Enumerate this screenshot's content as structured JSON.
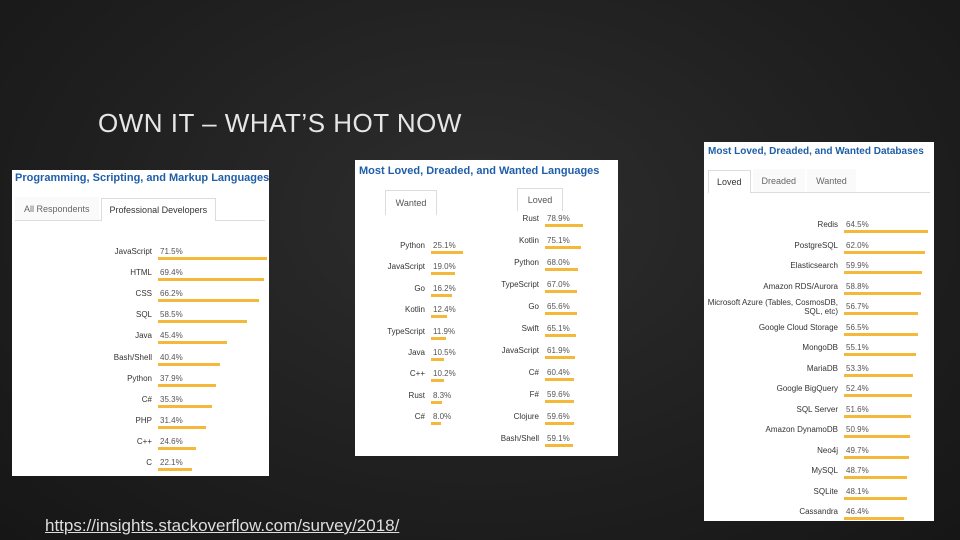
{
  "slide": {
    "title": "OWN IT – WHAT’S HOT NOW",
    "source_url": "https://insights.stackoverflow.com/survey/2018/"
  },
  "colors": {
    "bar": "#f4b93b",
    "title_blue": "#1f5ea8",
    "background": "#232323"
  },
  "panel_languages": {
    "title": "Programming, Scripting, and Markup Languages",
    "tabs": [
      "All Respondents",
      "Professional Developers"
    ],
    "active_tab": 1,
    "rows": [
      {
        "label": "JavaScript",
        "value": "71.5%",
        "pct": 71.5
      },
      {
        "label": "HTML",
        "value": "69.4%",
        "pct": 69.4
      },
      {
        "label": "CSS",
        "value": "66.2%",
        "pct": 66.2
      },
      {
        "label": "SQL",
        "value": "58.5%",
        "pct": 58.5
      },
      {
        "label": "Java",
        "value": "45.4%",
        "pct": 45.4
      },
      {
        "label": "Bash/Shell",
        "value": "40.4%",
        "pct": 40.4
      },
      {
        "label": "Python",
        "value": "37.9%",
        "pct": 37.9
      },
      {
        "label": "C#",
        "value": "35.3%",
        "pct": 35.3
      },
      {
        "label": "PHP",
        "value": "31.4%",
        "pct": 31.4
      },
      {
        "label": "C++",
        "value": "24.6%",
        "pct": 24.6
      },
      {
        "label": "C",
        "value": "22.1%",
        "pct": 22.1
      }
    ]
  },
  "panel_loved": {
    "title": "Most Loved, Dreaded, and Wanted Languages",
    "wanted_tab": "Wanted",
    "loved_tab": "Loved",
    "wanted_rows": [
      {
        "label": "Python",
        "value": "25.1%",
        "pct": 25.1
      },
      {
        "label": "JavaScript",
        "value": "19.0%",
        "pct": 19.0
      },
      {
        "label": "Go",
        "value": "16.2%",
        "pct": 16.2
      },
      {
        "label": "Kotlin",
        "value": "12.4%",
        "pct": 12.4
      },
      {
        "label": "TypeScript",
        "value": "11.9%",
        "pct": 11.9
      },
      {
        "label": "Java",
        "value": "10.5%",
        "pct": 10.5
      },
      {
        "label": "C++",
        "value": "10.2%",
        "pct": 10.2
      },
      {
        "label": "Rust",
        "value": "8.3%",
        "pct": 8.3
      },
      {
        "label": "C#",
        "value": "8.0%",
        "pct": 8.0
      }
    ],
    "loved_rows": [
      {
        "label": "Rust",
        "value": "78.9%",
        "pct": 78.9
      },
      {
        "label": "Kotlin",
        "value": "75.1%",
        "pct": 75.1
      },
      {
        "label": "Python",
        "value": "68.0%",
        "pct": 68.0
      },
      {
        "label": "TypeScript",
        "value": "67.0%",
        "pct": 67.0
      },
      {
        "label": "Go",
        "value": "65.6%",
        "pct": 65.6
      },
      {
        "label": "Swift",
        "value": "65.1%",
        "pct": 65.1
      },
      {
        "label": "JavaScript",
        "value": "61.9%",
        "pct": 61.9
      },
      {
        "label": "C#",
        "value": "60.4%",
        "pct": 60.4
      },
      {
        "label": "F#",
        "value": "59.6%",
        "pct": 59.6
      },
      {
        "label": "Clojure",
        "value": "59.6%",
        "pct": 59.6
      },
      {
        "label": "Bash/Shell",
        "value": "59.1%",
        "pct": 59.1
      }
    ]
  },
  "panel_databases": {
    "title": "Most Loved, Dreaded, and Wanted Databases",
    "tabs": [
      "Loved",
      "Dreaded",
      "Wanted"
    ],
    "active_tab": 0,
    "rows": [
      {
        "label": "Redis",
        "value": "64.5%",
        "pct": 64.5
      },
      {
        "label": "PostgreSQL",
        "value": "62.0%",
        "pct": 62.0
      },
      {
        "label": "Elasticsearch",
        "value": "59.9%",
        "pct": 59.9
      },
      {
        "label": "Amazon RDS/Aurora",
        "value": "58.8%",
        "pct": 58.8
      },
      {
        "label": "Microsoft Azure (Tables, CosmosDB, SQL, etc)",
        "value": "56.7%",
        "pct": 56.7
      },
      {
        "label": "Google Cloud Storage",
        "value": "56.5%",
        "pct": 56.5
      },
      {
        "label": "MongoDB",
        "value": "55.1%",
        "pct": 55.1
      },
      {
        "label": "MariaDB",
        "value": "53.3%",
        "pct": 53.3
      },
      {
        "label": "Google BigQuery",
        "value": "52.4%",
        "pct": 52.4
      },
      {
        "label": "SQL Server",
        "value": "51.6%",
        "pct": 51.6
      },
      {
        "label": "Amazon DynamoDB",
        "value": "50.9%",
        "pct": 50.9
      },
      {
        "label": "Neo4j",
        "value": "49.7%",
        "pct": 49.7
      },
      {
        "label": "MySQL",
        "value": "48.7%",
        "pct": 48.7
      },
      {
        "label": "SQLite",
        "value": "48.1%",
        "pct": 48.1
      },
      {
        "label": "Cassandra",
        "value": "46.4%",
        "pct": 46.4
      }
    ]
  }
}
